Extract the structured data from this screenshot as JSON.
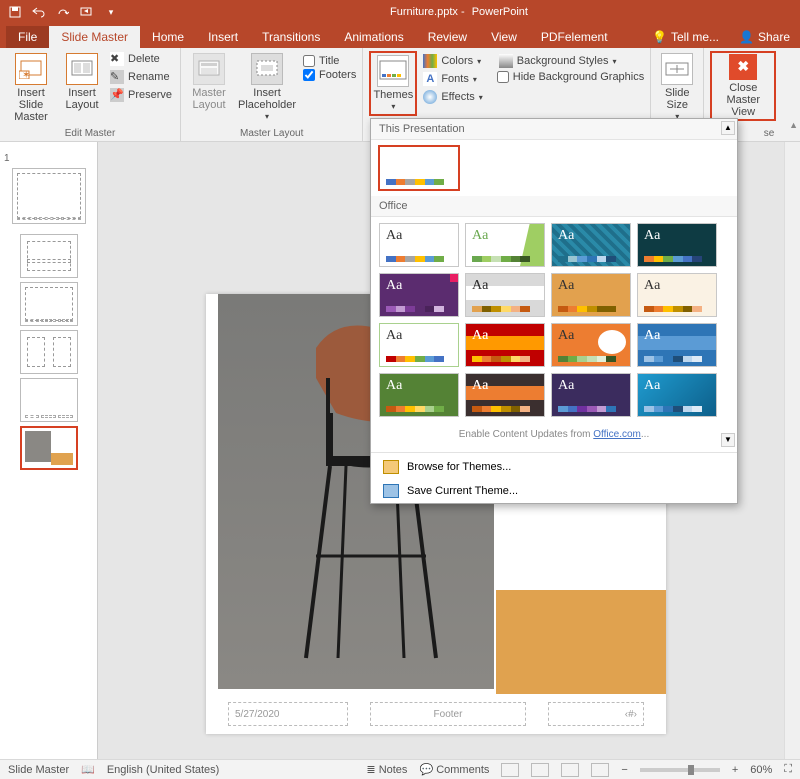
{
  "titlebar": {
    "filename": "Furniture.pptx",
    "appname": "PowerPoint"
  },
  "tabs": {
    "file": "File",
    "slide_master": "Slide Master",
    "home": "Home",
    "insert": "Insert",
    "transitions": "Transitions",
    "animations": "Animations",
    "review": "Review",
    "view": "View",
    "pdfelement": "PDFelement",
    "tellme": "Tell me...",
    "share": "Share"
  },
  "ribbon": {
    "edit_master": {
      "insert_slide_master": "Insert Slide Master",
      "insert_layout": "Insert Layout",
      "delete": "Delete",
      "rename": "Rename",
      "preserve": "Preserve",
      "label": "Edit Master"
    },
    "master_layout": {
      "master_layout": "Master Layout",
      "insert_placeholder": "Insert Placeholder",
      "title": "Title",
      "footers": "Footers",
      "label": "Master Layout"
    },
    "edit_theme": {
      "themes": "Themes",
      "colors": "Colors",
      "fonts": "Fonts",
      "effects": "Effects"
    },
    "background": {
      "styles": "Background Styles",
      "hide": "Hide Background Graphics"
    },
    "size": {
      "slide_size": "Slide Size"
    },
    "close": {
      "close": "Close Master View",
      "label": "se"
    }
  },
  "themes_panel": {
    "this_presentation": "This Presentation",
    "office": "Office",
    "enable_prefix": "Enable Content Updates from ",
    "enable_link": "Office.com",
    "enable_suffix": "...",
    "browse": "Browse for Themes...",
    "save": "Save Current Theme...",
    "tiles": [
      {
        "aa": "Aa",
        "bg": "#ffffff",
        "fg": "#333",
        "c": [
          "#4472c4",
          "#ed7d31",
          "#a5a5a5",
          "#ffc000",
          "#5b9bd5",
          "#70ad47"
        ]
      },
      {
        "aa": "Aa",
        "bg": "#ffffff",
        "fg": "#6aa84f",
        "c": [
          "#6aa84f",
          "#9fce63",
          "#c6e0b4",
          "#70ad47",
          "#548235",
          "#385723"
        ],
        "accent": "#9fce63"
      },
      {
        "aa": "Aa",
        "bg": "#1f6f8b",
        "fg": "#fff",
        "pattern": true,
        "c": [
          "#1f6f8b",
          "#99c5d1",
          "#5b9bd5",
          "#2e75b6",
          "#bdd7ee",
          "#1f4e79"
        ]
      },
      {
        "aa": "Aa",
        "bg": "#0e3b43",
        "fg": "#fff",
        "c": [
          "#ed7d31",
          "#ffc000",
          "#70ad47",
          "#5b9bd5",
          "#4472c4",
          "#264478"
        ]
      },
      {
        "aa": "Aa",
        "bg": "#5b2c6f",
        "fg": "#fff",
        "c": [
          "#9b59b6",
          "#c39bd3",
          "#7d3c98",
          "#5b2c6f",
          "#4a235a",
          "#d2b4de"
        ],
        "corner": "#e91e63"
      },
      {
        "aa": "Aa",
        "bg": "#d9d9d9",
        "fg": "#333",
        "c": [
          "#e2a14e",
          "#7f6000",
          "#bf8f00",
          "#ffd966",
          "#f4b183",
          "#c55a11"
        ],
        "band": "#ffffff"
      },
      {
        "aa": "Aa",
        "bg": "#e2a14e",
        "fg": "#333",
        "c": [
          "#c55a11",
          "#ed7d31",
          "#ffc000",
          "#bf8f00",
          "#7f6000",
          "#806000"
        ]
      },
      {
        "aa": "Aa",
        "bg": "#faf2e4",
        "fg": "#333",
        "c": [
          "#c55a11",
          "#ed7d31",
          "#ffc000",
          "#bf8f00",
          "#806000",
          "#f4b183"
        ]
      },
      {
        "aa": "Aa",
        "bg": "#ffffff",
        "fg": "#333",
        "c": [
          "#c00000",
          "#ed7d31",
          "#ffc000",
          "#70ad47",
          "#5b9bd5",
          "#4472c4"
        ],
        "border": "#a9d18e"
      },
      {
        "aa": "Aa",
        "bg": "#c00000",
        "fg": "#fff",
        "c": [
          "#ffc000",
          "#ed7d31",
          "#c55a11",
          "#bf8f00",
          "#ffd966",
          "#f4b183"
        ],
        "band": "#ff9900"
      },
      {
        "aa": "Aa",
        "bg": "#ed7d31",
        "fg": "#333",
        "c": [
          "#548235",
          "#70ad47",
          "#a9d18e",
          "#c5e0b4",
          "#e2f0d9",
          "#375623"
        ],
        "blob": "#ffffff"
      },
      {
        "aa": "Aa",
        "bg": "#2e75b6",
        "fg": "#fff",
        "c": [
          "#9dc3e6",
          "#5b9bd5",
          "#2e75b6",
          "#1f4e79",
          "#bdd7ee",
          "#deebf7"
        ],
        "band": "#5b9bd5"
      },
      {
        "aa": "Aa",
        "bg": "#548235",
        "fg": "#fff",
        "c": [
          "#c55a11",
          "#ed7d31",
          "#ffc000",
          "#ffd966",
          "#a9d18e",
          "#70ad47"
        ]
      },
      {
        "aa": "Aa",
        "bg": "#3b2f2f",
        "fg": "#fff",
        "c": [
          "#c55a11",
          "#ed7d31",
          "#ffc000",
          "#bf8f00",
          "#806000",
          "#f4b183"
        ],
        "band": "#ed7d31"
      },
      {
        "aa": "Aa",
        "bg": "#3b2c5e",
        "fg": "#fff",
        "c": [
          "#5b9bd5",
          "#4472c4",
          "#7030a0",
          "#9b59b6",
          "#c39bd3",
          "#2e75b6"
        ]
      },
      {
        "aa": "Aa",
        "bg": "#1f9bcf",
        "fg": "#fff",
        "c": [
          "#9dc3e6",
          "#5b9bd5",
          "#2e75b6",
          "#1f4e79",
          "#bdd7ee",
          "#deebf7"
        ],
        "grad": true
      }
    ]
  },
  "slide": {
    "date": "5/27/2020",
    "footer": "Footer",
    "num": "‹#›"
  },
  "status": {
    "mode": "Slide Master",
    "lang": "English (United States)",
    "notes": "Notes",
    "comments": "Comments",
    "zoom": "60%"
  }
}
